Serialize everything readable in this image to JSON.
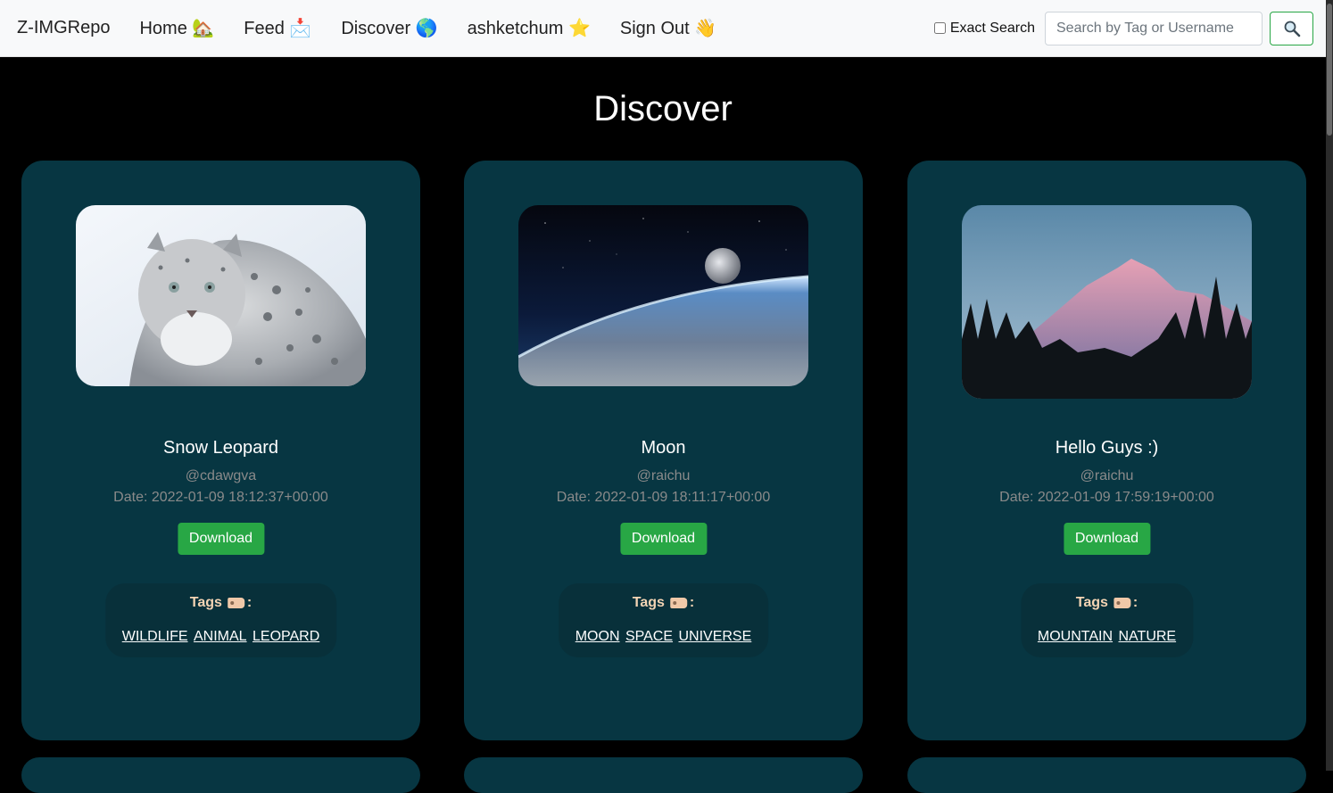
{
  "nav": {
    "brand": "Z-IMGRepo",
    "links": [
      {
        "label": "Home 🏡"
      },
      {
        "label": "Feed 📩"
      },
      {
        "label": "Discover 🌎"
      },
      {
        "label": "ashketchum ⭐"
      },
      {
        "label": "Sign Out 👋"
      }
    ],
    "exact_search_label": "Exact Search",
    "search_placeholder": "Search by Tag or Username"
  },
  "page": {
    "title": "Discover"
  },
  "cards": [
    {
      "title": "Snow Leopard",
      "user": "@cdawgva",
      "date": "Date: 2022-01-09 18:12:37+00:00",
      "download": "Download",
      "tags_label": "Tags",
      "tags_suffix": ":",
      "tags": [
        "WILDLIFE",
        "ANIMAL",
        "LEOPARD"
      ]
    },
    {
      "title": "Moon",
      "user": "@raichu",
      "date": "Date: 2022-01-09 18:11:17+00:00",
      "download": "Download",
      "tags_label": "Tags",
      "tags_suffix": ":",
      "tags": [
        "MOON",
        "SPACE",
        "UNIVERSE"
      ]
    },
    {
      "title": "Hello Guys :)",
      "user": "@raichu",
      "date": "Date: 2022-01-09 17:59:19+00:00",
      "download": "Download",
      "tags_label": "Tags",
      "tags_suffix": ":",
      "tags": [
        "MOUNTAIN",
        "NATURE"
      ]
    }
  ],
  "colors": {
    "card_bg": "#073642",
    "accent_green": "#28a745",
    "tag_title": "#f4d4b4"
  },
  "icons": {
    "search_button": "magnifier-icon",
    "tag": "label-tag-icon"
  }
}
